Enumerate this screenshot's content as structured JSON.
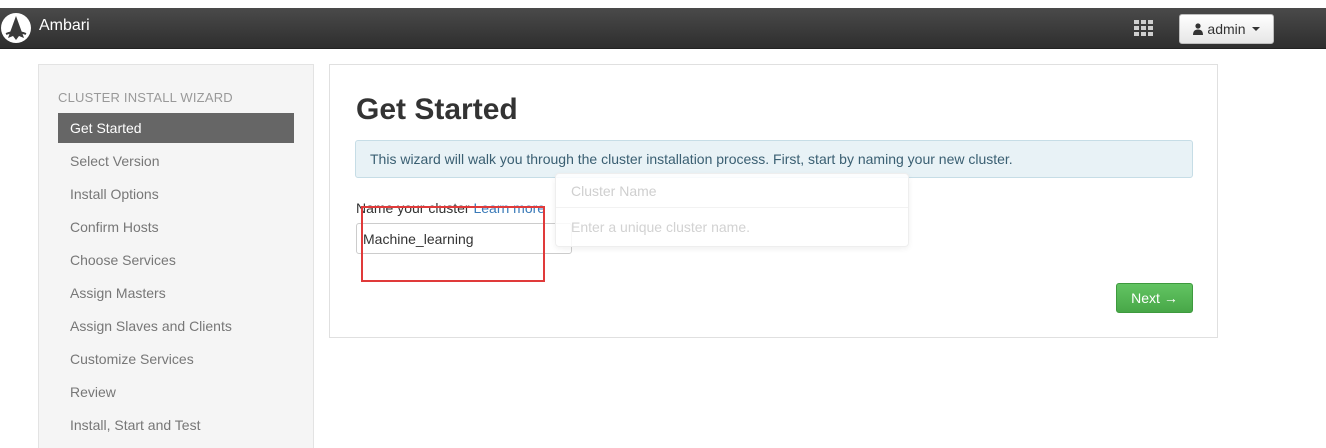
{
  "navbar": {
    "brand": "Ambari",
    "user_label": "admin"
  },
  "sidebar": {
    "title": "CLUSTER INSTALL WIZARD",
    "items": [
      {
        "label": "Get Started",
        "active": true
      },
      {
        "label": "Select Version"
      },
      {
        "label": "Install Options"
      },
      {
        "label": "Confirm Hosts"
      },
      {
        "label": "Choose Services"
      },
      {
        "label": "Assign Masters"
      },
      {
        "label": "Assign Slaves and Clients"
      },
      {
        "label": "Customize Services"
      },
      {
        "label": "Review"
      },
      {
        "label": "Install, Start and Test"
      }
    ]
  },
  "main": {
    "title": "Get Started",
    "alert": "This wizard will walk you through the cluster installation process. First, start by naming your new cluster.",
    "name_label": "Name your cluster",
    "learn_more": "Learn more",
    "cluster_name_value": "Machine_learning",
    "popover_title": "Cluster Name",
    "popover_body": "Enter a unique cluster name.",
    "next_label": "Next →"
  },
  "colors": {
    "navbar": "#3a3a3a",
    "sidebar_active": "#666666",
    "next_button": "#55b655",
    "highlight": "#e03a3a"
  }
}
